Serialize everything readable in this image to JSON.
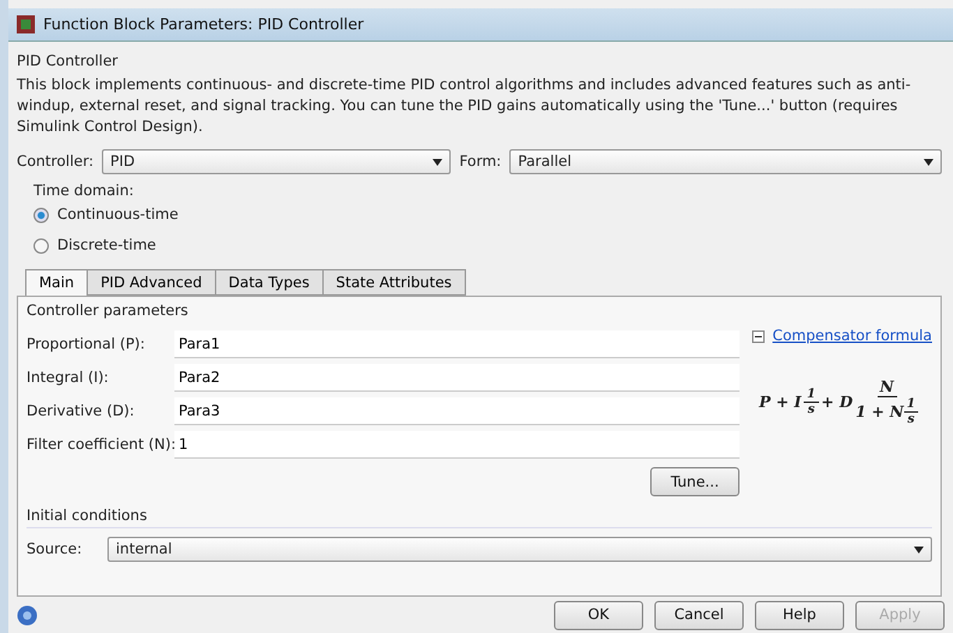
{
  "window": {
    "title": "Function Block Parameters: PID Controller"
  },
  "block_name": "PID Controller",
  "description": "This block implements continuous- and discrete-time PID control algorithms and includes advanced features such as anti-windup, external reset, and signal tracking. You can tune the PID gains automatically using the 'Tune...' button (requires Simulink Control Design).",
  "controller": {
    "label": "Controller:",
    "value": "PID"
  },
  "form": {
    "label": "Form:",
    "value": "Parallel"
  },
  "time_domain": {
    "label": "Time domain:",
    "options": [
      {
        "label": "Continuous-time",
        "selected": true
      },
      {
        "label": "Discrete-time",
        "selected": false
      }
    ]
  },
  "tabs": [
    {
      "label": "Main",
      "selected": true
    },
    {
      "label": "PID Advanced",
      "selected": false
    },
    {
      "label": "Data Types",
      "selected": false
    },
    {
      "label": "State Attributes",
      "selected": false
    }
  ],
  "controller_parameters": {
    "title": "Controller parameters",
    "fields": [
      {
        "label": "Proportional (P):",
        "value": "Para1"
      },
      {
        "label": "Integral (I):",
        "value": "Para2"
      },
      {
        "label": "Derivative (D):",
        "value": "Para3"
      },
      {
        "label": "Filter coefficient (N):",
        "value": "1"
      }
    ],
    "tune_button": "Tune...",
    "formula_link": "Compensator formula",
    "formula": {
      "a": "P + I",
      "f1_num": "1",
      "f1_den": "s",
      "b": "+ D",
      "f2_num": "N",
      "f2_den_a": "1 + N",
      "f3_num": "1",
      "f3_den": "s"
    }
  },
  "initial_conditions": {
    "title": "Initial conditions",
    "source_label": "Source:",
    "source_value": "internal"
  },
  "buttons": [
    {
      "label": "OK",
      "disabled": false
    },
    {
      "label": "Cancel",
      "disabled": false
    },
    {
      "label": "Help",
      "disabled": false
    },
    {
      "label": "Apply",
      "disabled": true
    }
  ]
}
